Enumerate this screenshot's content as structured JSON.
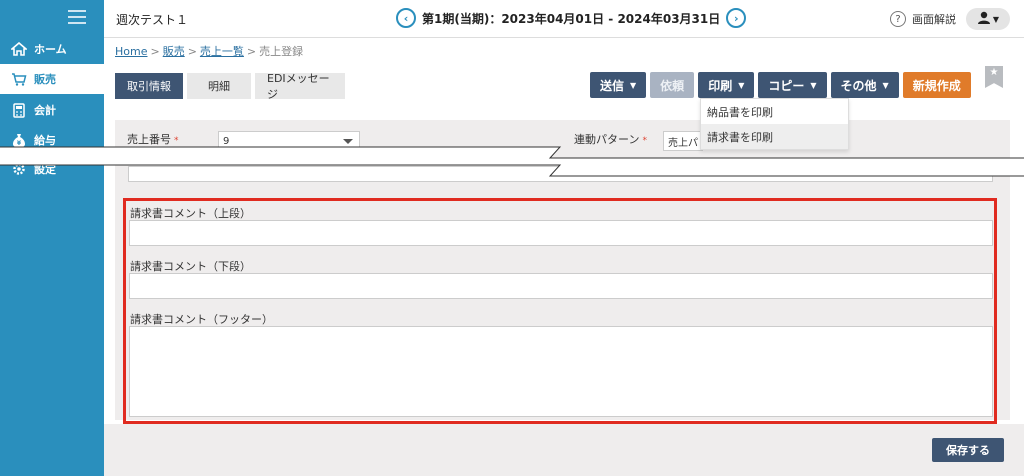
{
  "header": {
    "app_title": "週次テスト１",
    "period_text": "第1期(当期)：2023年04月01日 - 2024年03月31日",
    "help_label": "画面解説"
  },
  "sidebar": {
    "items": [
      {
        "label": "ホーム",
        "icon": "home-icon"
      },
      {
        "label": "販売",
        "icon": "cart-icon"
      },
      {
        "label": "会計",
        "icon": "calculator-icon"
      },
      {
        "label": "給与",
        "icon": "money-bag-icon"
      },
      {
        "label": "設定",
        "icon": "gear-icon"
      }
    ]
  },
  "breadcrumb": {
    "items": [
      "Home",
      "販売",
      "売上一覧"
    ],
    "current": "売上登録"
  },
  "tabs": [
    "取引情報",
    "明細",
    "EDIメッセージ"
  ],
  "toolbar": {
    "send": "送信",
    "request": "依頼",
    "print": "印刷",
    "copy": "コピー",
    "other": "その他",
    "new": "新規作成"
  },
  "print_menu": [
    "納品書を印刷",
    "請求書を印刷"
  ],
  "form": {
    "sales_number_label": "売上番号",
    "sales_number_value": "9",
    "linkage_pattern_label": "連動パターン",
    "linkage_pattern_value": "売上パ",
    "comment_upper_label": "請求書コメント（上段）",
    "comment_lower_label": "請求書コメント（下段）",
    "comment_footer_label": "請求書コメント（フッター）"
  },
  "save_label": "保存する",
  "colors": {
    "sidebar": "#2a8fbd",
    "button": "#3e5573",
    "new_button": "#e07b2a",
    "highlight": "#e02b20"
  }
}
